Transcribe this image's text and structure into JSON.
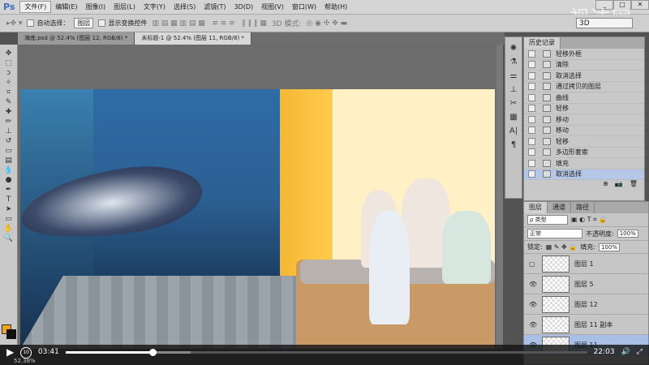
{
  "menubar": {
    "logo": "Ps",
    "items": [
      "文件(F)",
      "编辑(E)",
      "图像(I)",
      "图层(L)",
      "文字(Y)",
      "选择(S)",
      "滤镜(T)",
      "3D(D)",
      "视图(V)",
      "窗口(W)",
      "帮助(H)"
    ],
    "watermark": "视达网"
  },
  "options": {
    "auto_select_label": "自动选择：",
    "auto_select_value": "图层",
    "show_transform_label": "显示变换控件",
    "mode_3d_label": "3D 模式:",
    "select_3d": "3D"
  },
  "tabs": [
    "海底.psd @ 52.4% (图层 12, RGB/8) *",
    "未标题-1 @ 52.4% (图层 11, RGB/8) *"
  ],
  "history": {
    "title": "历史记录",
    "items": [
      "轻移外框",
      "清除",
      "取消选择",
      "通过拷贝的图层",
      "曲线",
      "轻移",
      "移动",
      "移动",
      "轻移",
      "多边形套索",
      "填充",
      "取消选择"
    ],
    "selected_index": 11
  },
  "layers": {
    "tabs": [
      "图层",
      "通道",
      "路径"
    ],
    "filter": "ρ 类型",
    "blend": "正常",
    "opacity_label": "不透明度:",
    "opacity": "100%",
    "lock_label": "锁定:",
    "fill_label": "填充:",
    "fill": "100%",
    "items": [
      {
        "name": "图层 1",
        "visible": false
      },
      {
        "name": "图层 5",
        "visible": true
      },
      {
        "name": "图层 12",
        "visible": true
      },
      {
        "name": "图层 11 副本",
        "visible": true
      },
      {
        "name": "图层 11",
        "visible": true,
        "selected": true
      }
    ]
  },
  "player": {
    "current": "03:41",
    "total": "22:03",
    "progress": 0.167,
    "buffered": 0.24,
    "replay_label": "10"
  },
  "status": {
    "zoom": "52.38%"
  },
  "colors": {
    "foreground": "#f7a21b",
    "background": "#111111",
    "accent_selection": "#b4c7e8"
  }
}
